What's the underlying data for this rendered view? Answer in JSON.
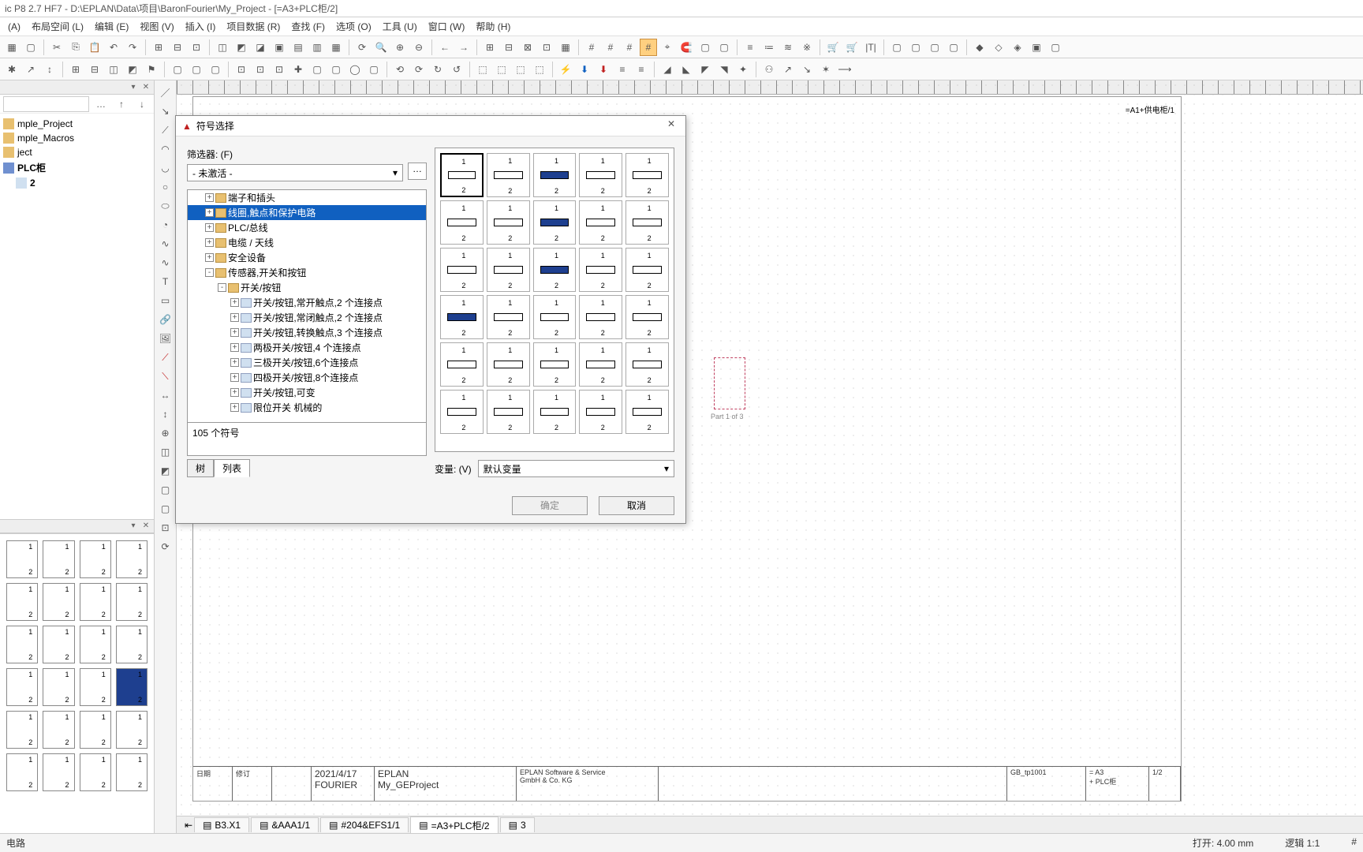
{
  "window": {
    "title": "ic P8 2.7 HF7 - D:\\EPLAN\\Data\\项目\\BaronFourier\\My_Project - [=A3+PLC柜/2]"
  },
  "menu": [
    "(A)",
    "布局空间 (L)",
    "编辑 (E)",
    "视图 (V)",
    "插入 (I)",
    "项目数据 (R)",
    "查找 (F)",
    "选项 (O)",
    "工具 (U)",
    "窗口 (W)",
    "帮助 (H)"
  ],
  "project_tree": {
    "items": [
      "mple_Project",
      "mple_Macros",
      "ject",
      "PLC柜",
      "  2"
    ],
    "bold_items": [
      "PLC柜",
      "  2"
    ]
  },
  "dialog": {
    "title": "符号选择",
    "filter_label": "筛选器: (F)",
    "filter_value": "- 未激活 -",
    "tree": [
      {
        "indent": 1,
        "exp": "+",
        "label": "端子和插头"
      },
      {
        "indent": 1,
        "exp": "+",
        "label": "线圈,触点和保护电路",
        "selected": true
      },
      {
        "indent": 1,
        "exp": "+",
        "label": "PLC/总线"
      },
      {
        "indent": 1,
        "exp": "+",
        "label": "电缆 / 天线"
      },
      {
        "indent": 1,
        "exp": "+",
        "label": "安全设备"
      },
      {
        "indent": 1,
        "exp": "-",
        "label": "传感器,开关和按钮"
      },
      {
        "indent": 2,
        "exp": "-",
        "label": "开关/按钮"
      },
      {
        "indent": 3,
        "exp": "+",
        "doc": true,
        "label": "开关/按钮,常开触点,2 个连接点"
      },
      {
        "indent": 3,
        "exp": "+",
        "doc": true,
        "label": "开关/按钮,常闭触点,2 个连接点"
      },
      {
        "indent": 3,
        "exp": "+",
        "doc": true,
        "label": "开关/按钮,转换触点,3 个连接点"
      },
      {
        "indent": 3,
        "exp": "+",
        "doc": true,
        "label": "两极开关/按钮,4 个连接点"
      },
      {
        "indent": 3,
        "exp": "+",
        "doc": true,
        "label": "三极开关/按钮,6个连接点"
      },
      {
        "indent": 3,
        "exp": "+",
        "doc": true,
        "label": "四极开关/按钮,8个连接点"
      },
      {
        "indent": 3,
        "exp": "+",
        "doc": true,
        "label": "开关/按钮,可变"
      },
      {
        "indent": 3,
        "exp": "+",
        "doc": true,
        "label": "限位开关 机械的"
      }
    ],
    "status_text": "105 个符号",
    "tabs": [
      "树",
      "列表"
    ],
    "active_tab": 1,
    "variant_label": "变量: (V)",
    "variant_value": "默认变量",
    "ok": "确定",
    "cancel": "取消",
    "preview_count": 30
  },
  "canvas": {
    "ref_text": "=A1+供电柜/1",
    "page_marker": "Part 1 of 3",
    "title_block": {
      "col1": [
        "日期",
        "修订",
        " "
      ],
      "date": "2021/4/17",
      "author": "FOURIER",
      "company": "EPLAN",
      "project": "My_GEProject",
      "company2": "EPLAN Software & Service\nGmbH & Co. KG",
      "loc": "= A3\n+ PLC柜",
      "sheet": "GB_tp1001",
      "page": "1/2"
    }
  },
  "tabs": {
    "items": [
      "B3.X1",
      "&AAA1/1",
      "#204&EFS1/1",
      "=A3+PLC柜/2",
      "3"
    ],
    "active": 3
  },
  "status": {
    "left": "电路",
    "open": "打开: 4.00 mm",
    "logic": "逻辑 1:1",
    "hash": "#"
  }
}
